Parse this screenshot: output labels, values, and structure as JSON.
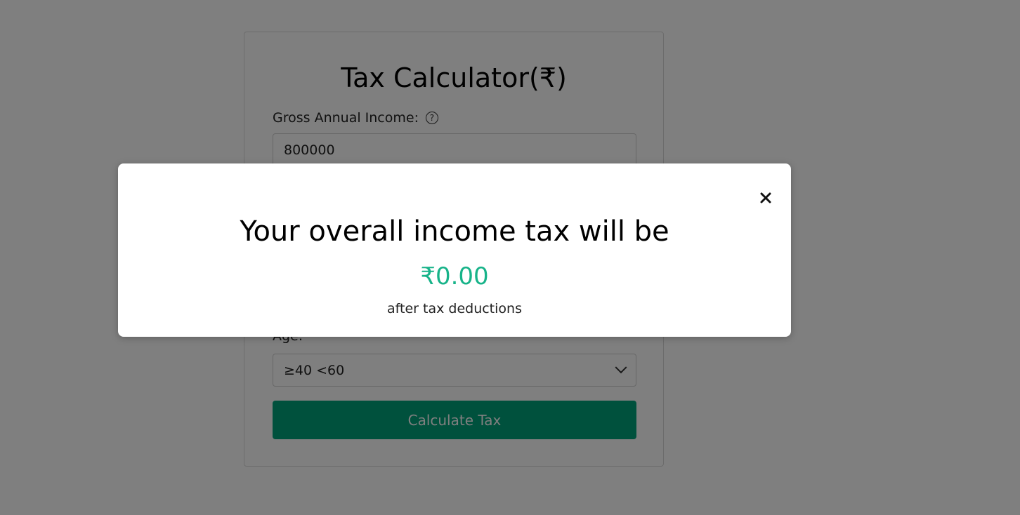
{
  "form": {
    "title": "Tax Calculator(₹)",
    "income_label": "Gross Annual Income:",
    "income_value": "800000",
    "age_label": "Age:",
    "age_value": "≥40 <60",
    "calculate_label": "Calculate Tax"
  },
  "modal": {
    "heading": "Your overall income tax will be",
    "amount": "₹0.00",
    "subtext": "after tax deductions",
    "close_icon": "close-icon"
  },
  "colors": {
    "accent": "#00a27a",
    "amount": "#17b389",
    "overlay": "rgba(0,0,0,0.5)"
  }
}
